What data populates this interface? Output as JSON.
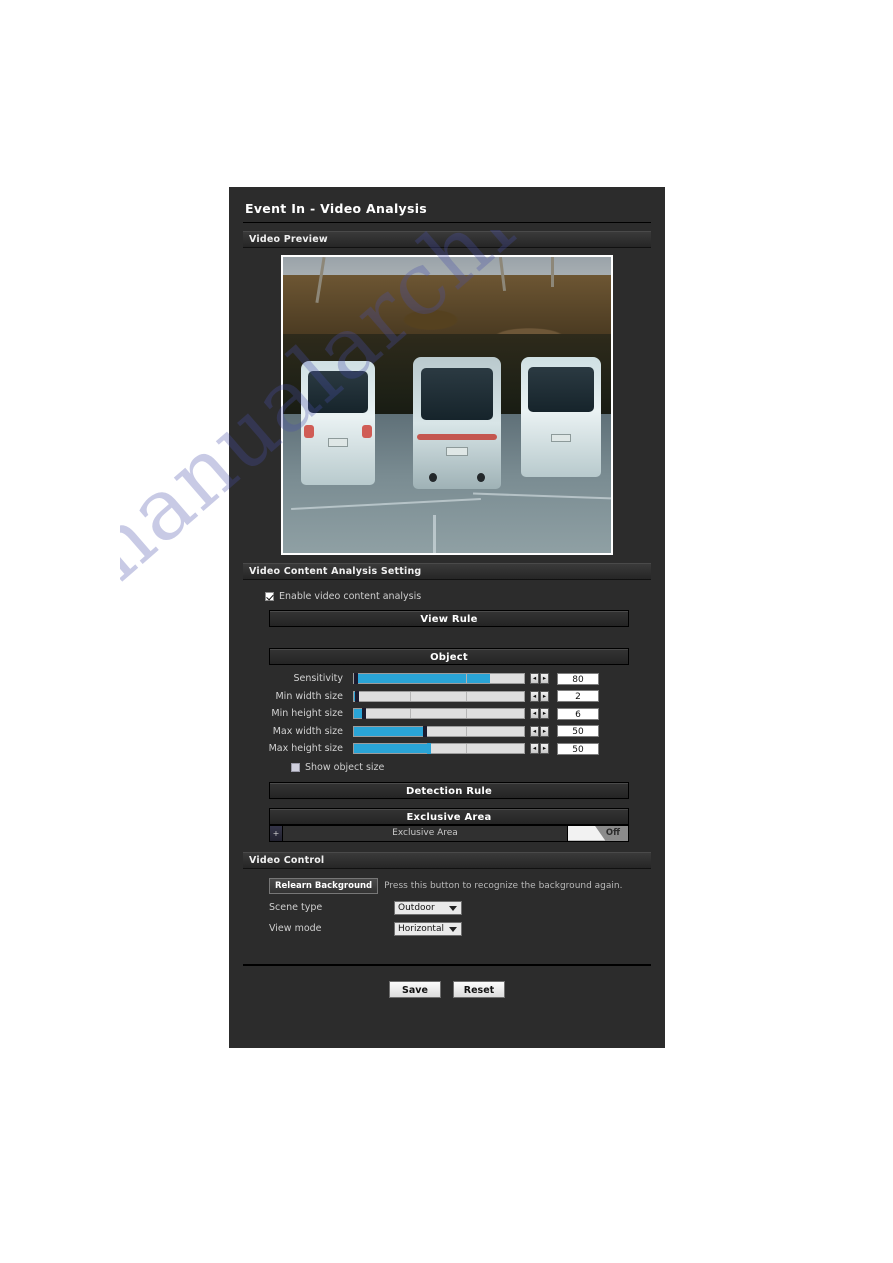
{
  "watermark": {
    "text": "manualarchive.com"
  },
  "page": {
    "title": "Event In - Video Analysis"
  },
  "sections": {
    "video_preview": {
      "header": "Video Preview"
    },
    "vca": {
      "header": "Video Content Analysis Setting"
    },
    "video_control": {
      "header": "Video Control"
    }
  },
  "vca": {
    "enable_checkbox": {
      "label": "Enable video content analysis",
      "checked": true
    },
    "view_rule_button": "View Rule",
    "object_header": "Object",
    "sliders": [
      {
        "label": "Sensitivity",
        "value": "80",
        "fill_pct": 80
      },
      {
        "label": "Min width size",
        "value": "2",
        "fill_pct": 2
      },
      {
        "label": "Min height size",
        "value": "6",
        "fill_pct": 6
      },
      {
        "label": "Max width size",
        "value": "50",
        "fill_pct": 41
      },
      {
        "label": "Max height size",
        "value": "50",
        "fill_pct": 45
      }
    ],
    "spinner": {
      "dec": "◂",
      "inc": "▸"
    },
    "show_object_size": {
      "label": "Show object size",
      "checked": false
    },
    "detection_rule_button": "Detection Rule",
    "exclusive_area_header": "Exclusive Area",
    "exclusive_area_row": {
      "expand": "+",
      "name": "Exclusive Area",
      "toggle_state": "Off"
    }
  },
  "video_control": {
    "relearn_button": "Relearn Background",
    "relearn_note": "Press this button to recognize the background again.",
    "scene_type": {
      "label": "Scene type",
      "value": "Outdoor"
    },
    "view_mode": {
      "label": "View mode",
      "value": "Horizontal"
    }
  },
  "footer": {
    "save": "Save",
    "reset": "Reset"
  },
  "colors": {
    "panel_bg": "#2c2c2c",
    "slider_fill": "#2aa4d6",
    "slider_track": "#dedede",
    "text": "#e2e2e2"
  }
}
